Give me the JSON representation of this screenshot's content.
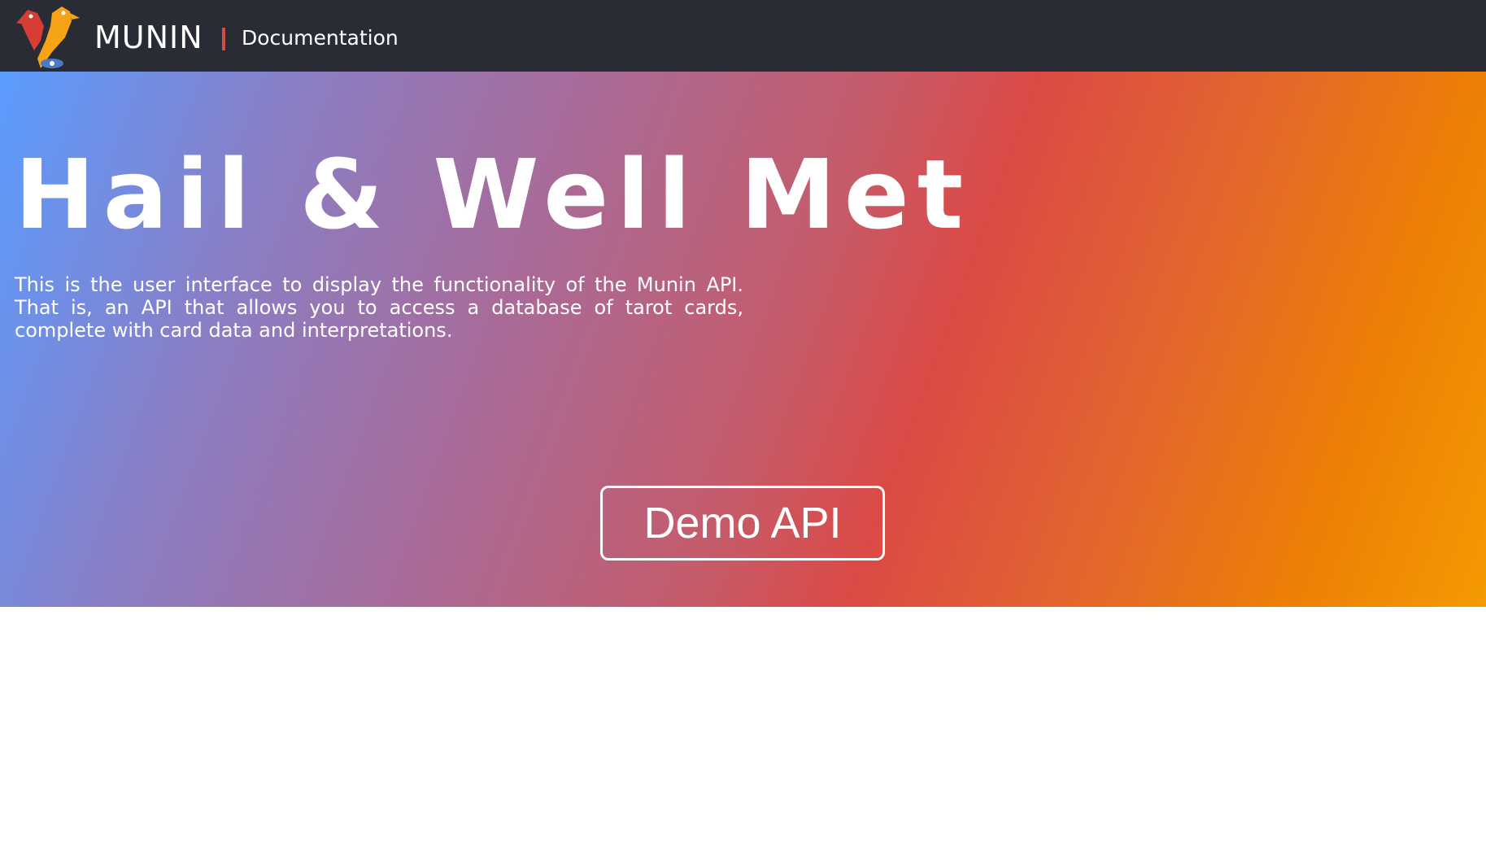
{
  "navbar": {
    "logo_icon": "raven-logo-icon",
    "brand": "MUNIN",
    "separator": "|",
    "documentation_link": "Documentation",
    "background_color": "#2a2c35",
    "separator_color": "#d64a4a"
  },
  "hero": {
    "title": "Hail & Well Met",
    "description": "This is the user interface to display the functionality of the Munin API. That is, an API that allows you to access a database of tarot cards, complete with card data and interpretations.",
    "demo_button": "Demo API",
    "gradient_colors": [
      "#5a9cff",
      "#8a7ec4",
      "#c45c6c",
      "#dc4a45",
      "#ec7f06",
      "#f59a02"
    ]
  }
}
